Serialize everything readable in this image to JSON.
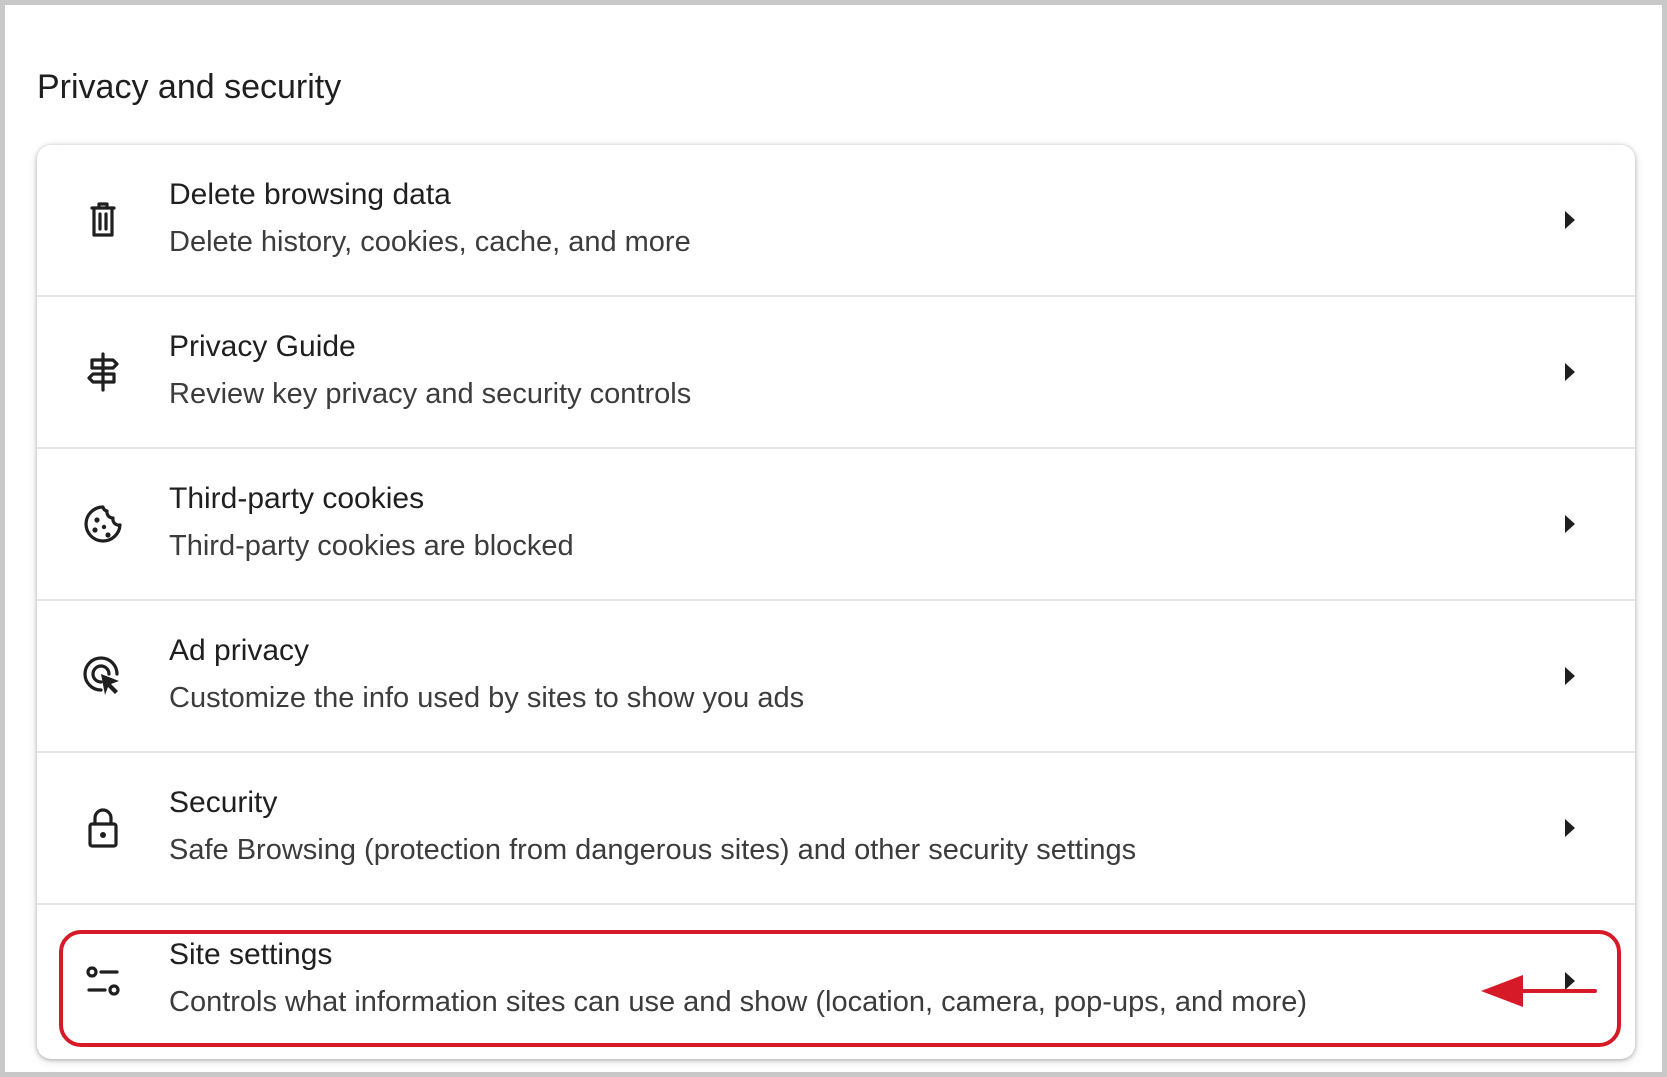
{
  "section": {
    "title": "Privacy and security"
  },
  "rows": [
    {
      "icon": "trash-icon",
      "title": "Delete browsing data",
      "subtitle": "Delete history, cookies, cache, and more"
    },
    {
      "icon": "signpost-icon",
      "title": "Privacy Guide",
      "subtitle": "Review key privacy and security controls"
    },
    {
      "icon": "cookie-icon",
      "title": "Third-party cookies",
      "subtitle": "Third-party cookies are blocked"
    },
    {
      "icon": "ad-privacy-cursor-icon",
      "title": "Ad privacy",
      "subtitle": "Customize the info used by sites to show you ads"
    },
    {
      "icon": "lock-icon",
      "title": "Security",
      "subtitle": "Safe Browsing (protection from dangerous sites) and other security settings"
    },
    {
      "icon": "tune-sliders-icon",
      "title": "Site settings",
      "subtitle": "Controls what information sites can use and show (location, camera, pop-ups, and more)"
    }
  ],
  "colors": {
    "annotation": "#d71a28",
    "text": "#1f1f1f",
    "divider": "#e6e6e6"
  }
}
